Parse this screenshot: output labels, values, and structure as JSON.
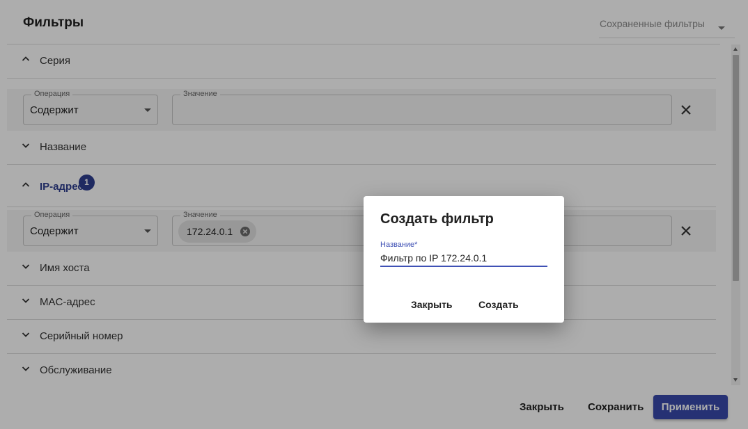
{
  "header": {
    "title": "Фильтры",
    "saved_filters_label": "Сохраненные фильтры"
  },
  "filters": [
    {
      "label": "Серия",
      "expanded": true
    },
    {
      "label": "Название",
      "expanded": false
    },
    {
      "label": "IP-адрес",
      "expanded": true,
      "badge": "1"
    },
    {
      "label": "Имя хоста",
      "expanded": false
    },
    {
      "label": "MAC-адрес",
      "expanded": false
    },
    {
      "label": "Серийный номер",
      "expanded": false
    },
    {
      "label": "Обслуживание",
      "expanded": false
    }
  ],
  "series_filter": {
    "operation_label": "Операция",
    "operation_value": "Содержит",
    "value_label": "Значение"
  },
  "ip_filter": {
    "operation_label": "Операция",
    "operation_value": "Содержит",
    "value_label": "Значение",
    "chip": "172.24.0.1"
  },
  "footer": {
    "close_label": "Закрыть",
    "save_label": "Сохранить",
    "apply_label": "Применить"
  },
  "dialog": {
    "title": "Создать фильтр",
    "name_label": "Название*",
    "name_value": "Фильтр по IP 172.24.0.1",
    "close_label": "Закрыть",
    "create_label": "Создать"
  },
  "colors": {
    "primary": "#3949ab",
    "active_text": "#2f3e8f",
    "overlay": "rgba(0,0,0,0.32)"
  }
}
